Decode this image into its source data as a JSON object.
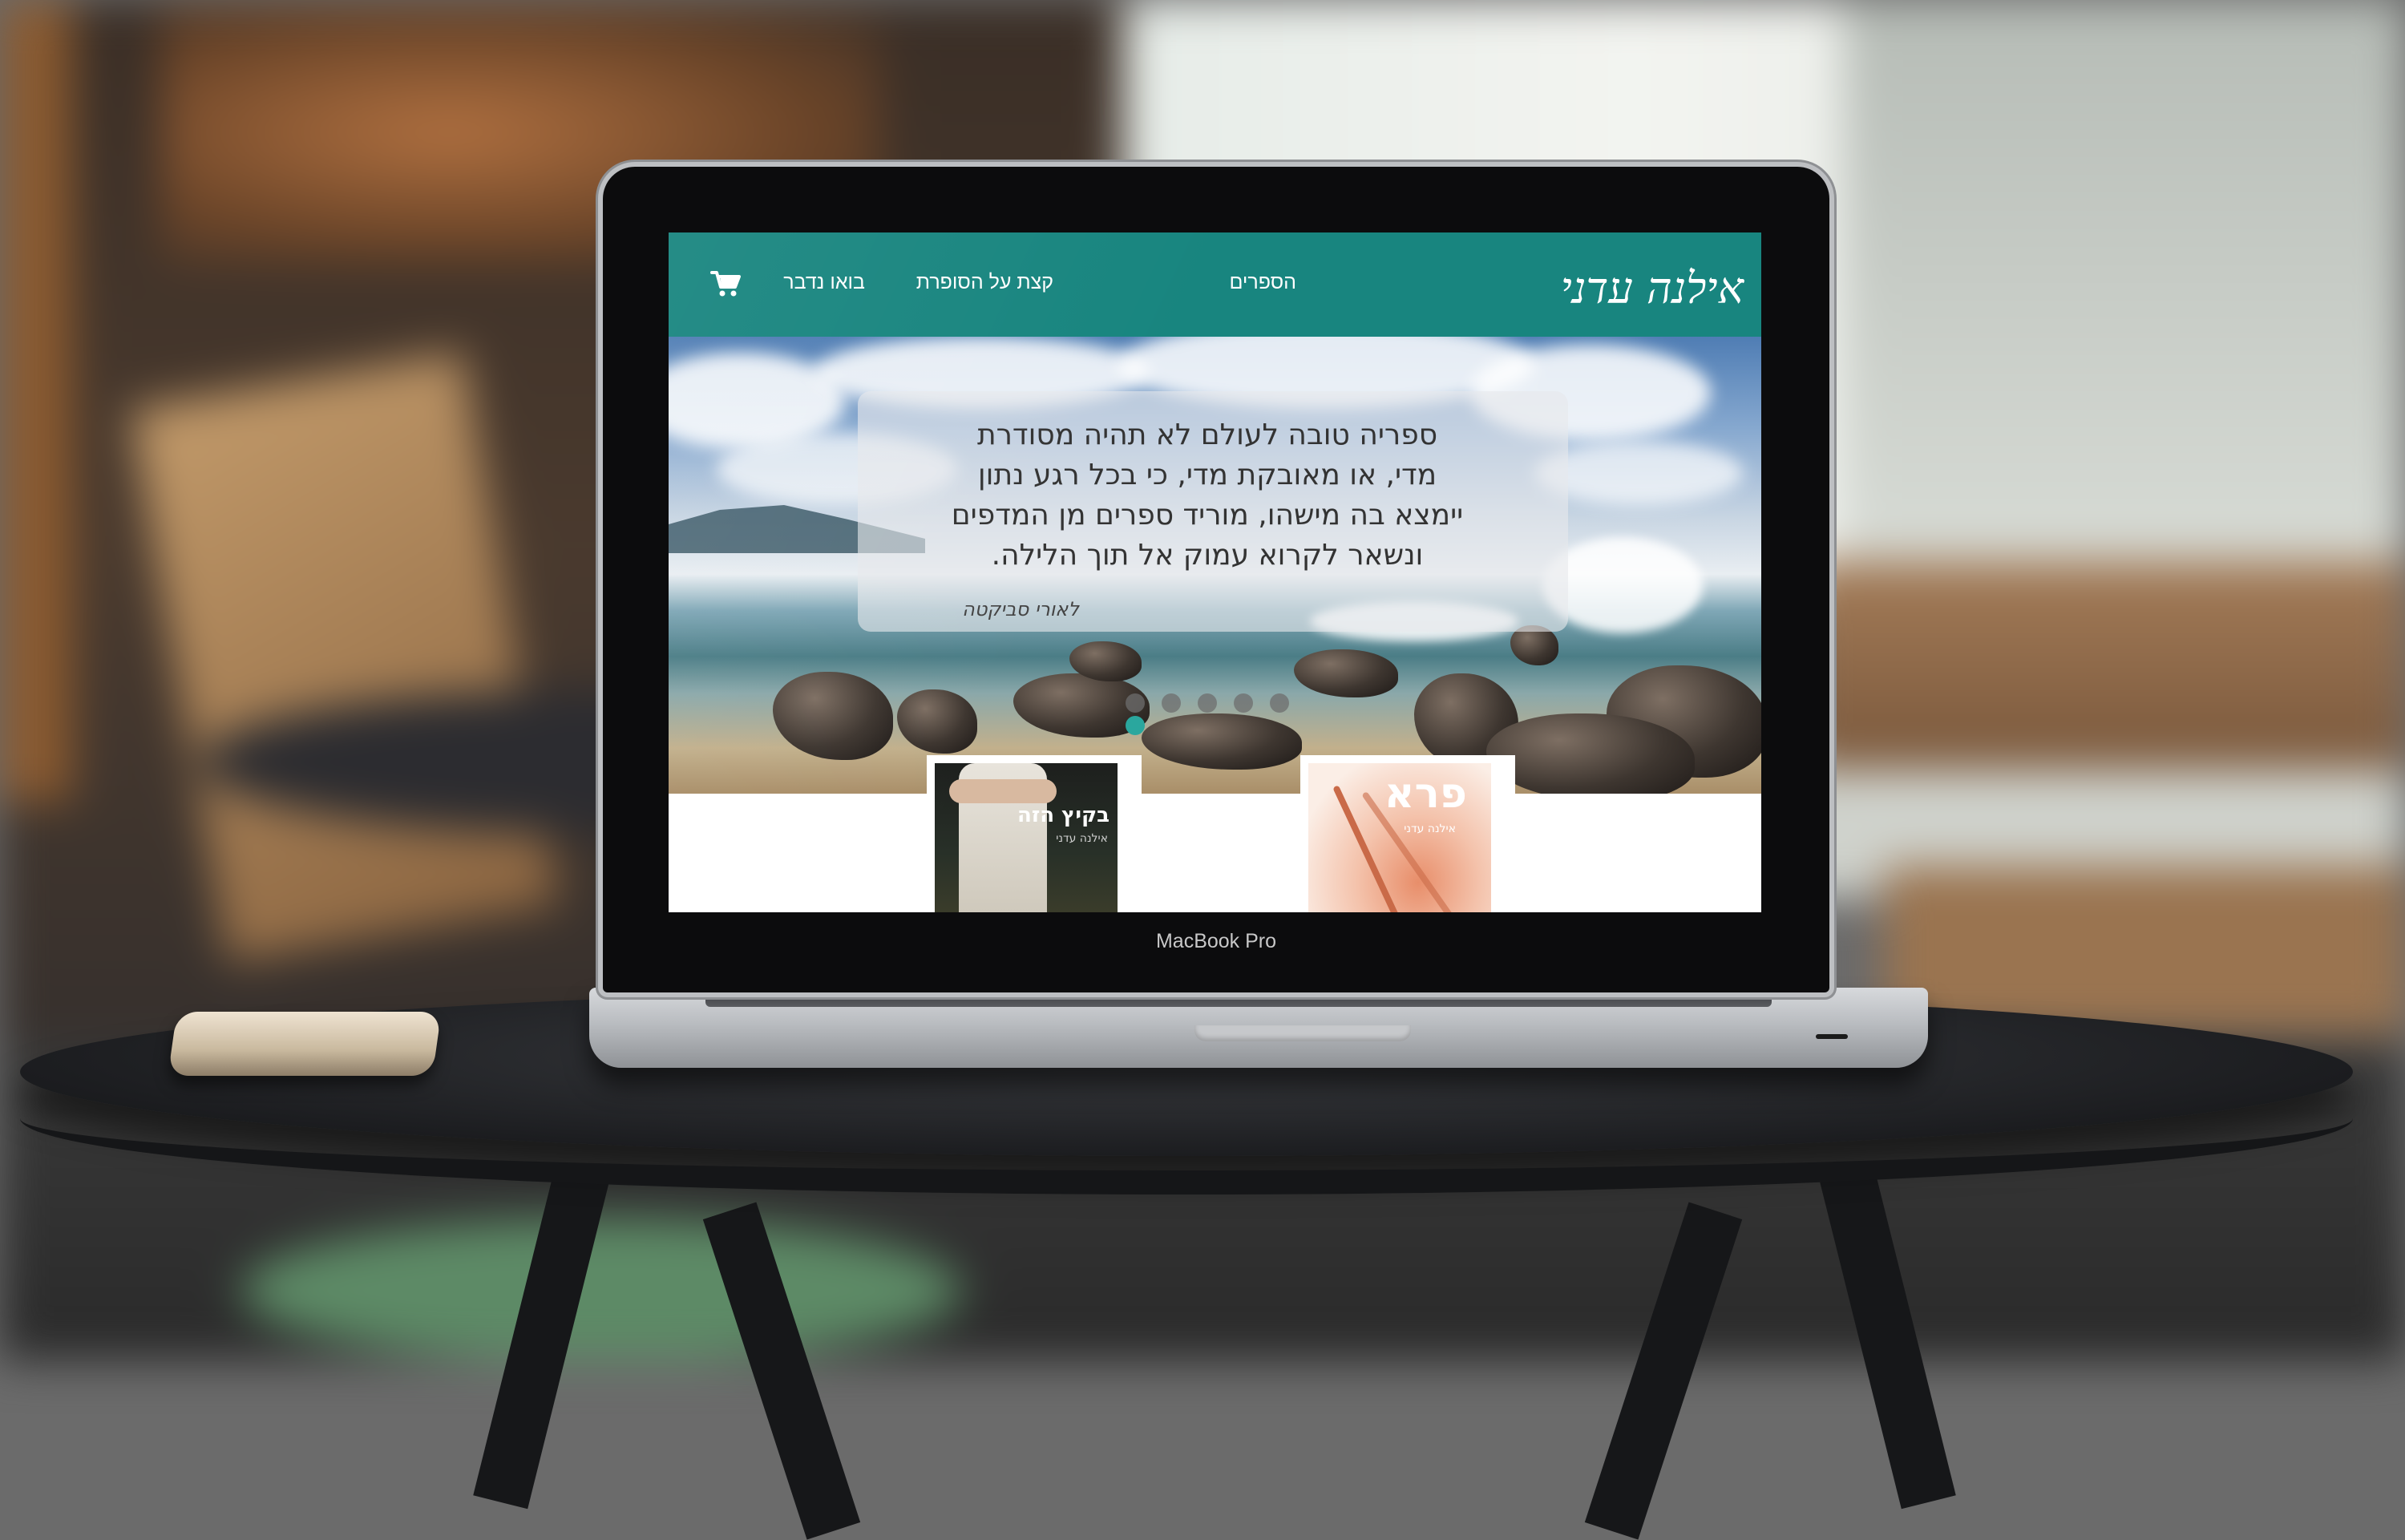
{
  "device": {
    "brand_label": "MacBook Pro"
  },
  "site": {
    "logo_text": "אילנה עדני",
    "nav": {
      "books": "הספרים",
      "about": "קצת על הסופרת",
      "contact": "בואו נדבר"
    },
    "colors": {
      "header": "#18857f",
      "active_dot": "#2aa79e"
    },
    "icons": {
      "cart": "shopping-cart-icon"
    },
    "hero": {
      "quote_lines": [
        "ספריה טובה לעולם לא תהיה מסודרת",
        "מדי, או מאובקת מדי, כי בכל רגע נתון",
        "יימצא בה מישהו, מוריד ספרים מן המדפים",
        "ונשאר לקרוא עמוק אל תוך הלילה."
      ],
      "quote_author": "לאורי סביקטה",
      "slider": {
        "count": 6,
        "active_index": 0
      }
    },
    "books": [
      {
        "title": "בקיץ הזה",
        "author": "אילנה עדני"
      },
      {
        "title": "פרא",
        "author": "אילנה עדני"
      }
    ]
  }
}
